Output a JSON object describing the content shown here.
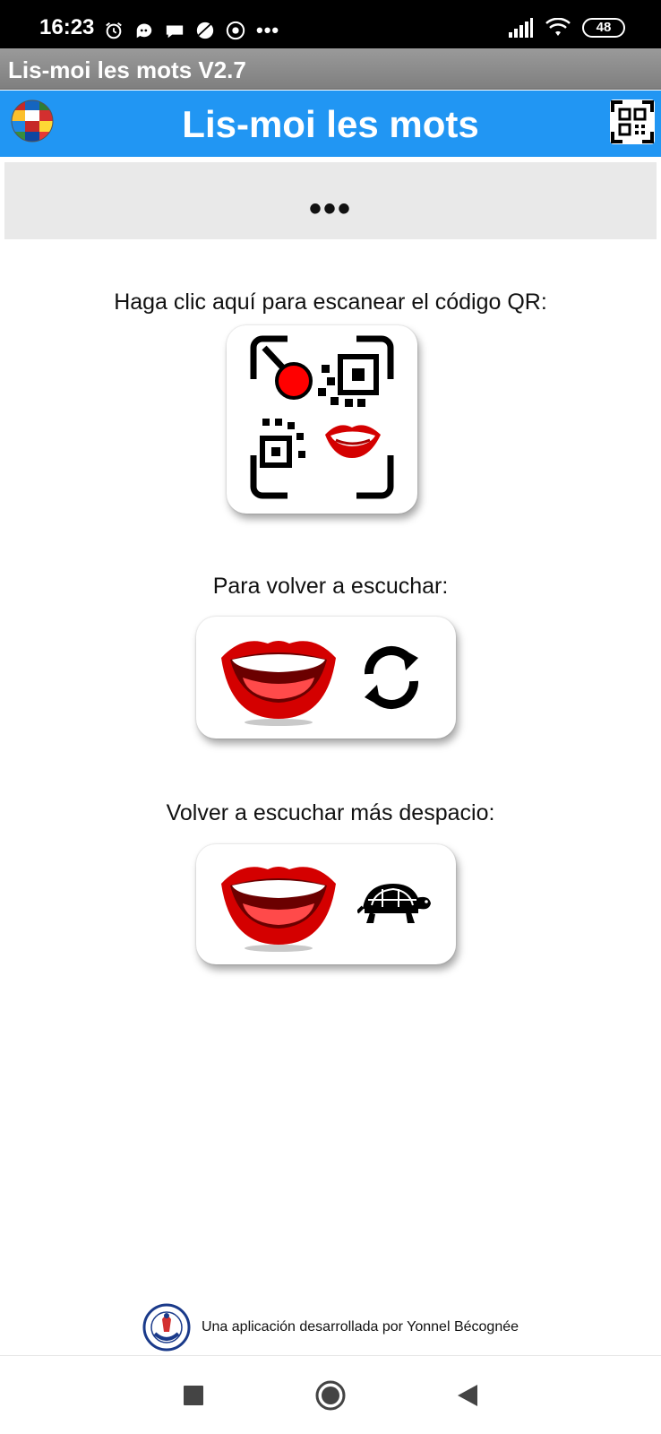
{
  "status_bar": {
    "time": "16:23",
    "more": "•••",
    "battery": "48"
  },
  "window": {
    "title": "Lis-moi les mots V2.7"
  },
  "header": {
    "title": "Lis-moi les mots",
    "color": "#2196f3"
  },
  "display": {
    "text": "•••"
  },
  "scan": {
    "label": "Haga clic aquí para escanear el código QR:"
  },
  "replay": {
    "label": "Para volver a escuchar:"
  },
  "replay_slow": {
    "label": "Volver a escuchar más despacio:"
  },
  "footer": {
    "text": "Una aplicación desarrollada por Yonnel Bécognée"
  },
  "icons": {
    "globe": "globe-flags-icon",
    "qr": "qr-code-icon",
    "mouth": "mouth-icon",
    "refresh": "refresh-icon",
    "turtle": "turtle-icon"
  }
}
